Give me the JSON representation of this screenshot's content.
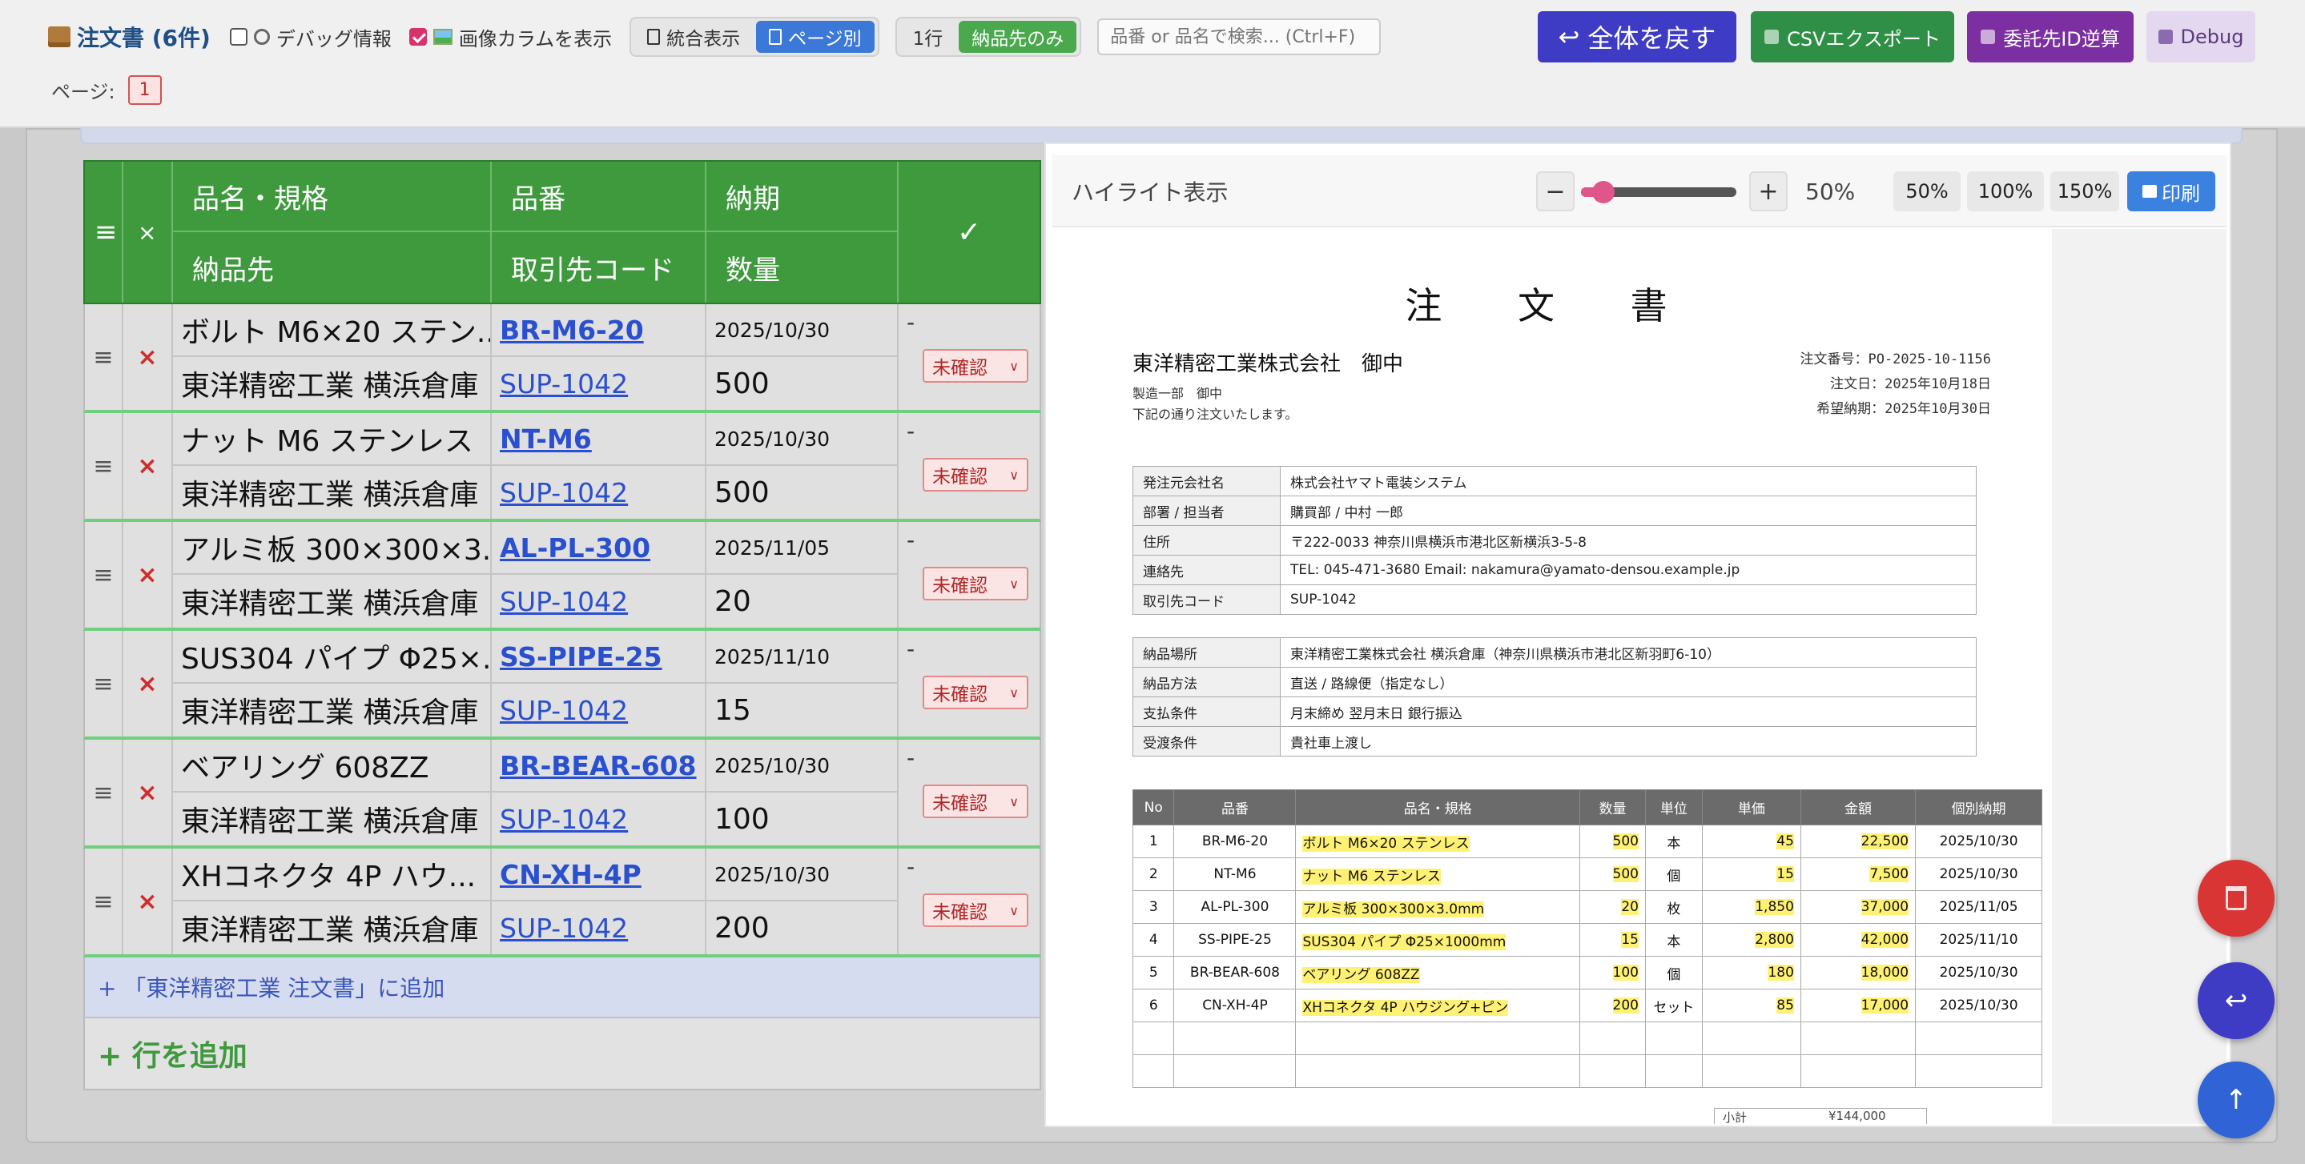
{
  "header": {
    "title": "注文書 (6件)",
    "debug_info_label": "デバッグ情報",
    "image_column_label": "画像カラムを表示",
    "view_combined": "統合表示",
    "view_by_page": "ページ別",
    "one_row": "1行",
    "delivery_only": "納品先のみ",
    "search_placeholder": "品番 or 品名で検索... (Ctrl+F)",
    "revert_all": "全体を戻す",
    "csv_export": "CSVエクスポート",
    "consignee_id_calc": "委託先ID逆算",
    "debug": "Debug",
    "page_label": "ページ:",
    "page_number": "1",
    "revert_icon": "↩"
  },
  "table": {
    "headers": {
      "drag": "≡",
      "delete": "×",
      "name_spec": "品名・規格",
      "delivery_dest": "納品先",
      "part_no": "品番",
      "supplier_code": "取引先コード",
      "due_date": "納期",
      "quantity": "数量",
      "check": "✓"
    },
    "rows": [
      {
        "name": "ボルト M6×20 ステン...",
        "code": "BR-M6-20",
        "date": "2025/10/30",
        "dest": "東洋精密工業 横浜倉庫",
        "sup": "SUP-1042",
        "qty": "500",
        "dash": "-",
        "status": "未確認"
      },
      {
        "name": "ナット M6 ステンレス",
        "code": "NT-M6",
        "date": "2025/10/30",
        "dest": "東洋精密工業 横浜倉庫",
        "sup": "SUP-1042",
        "qty": "500",
        "dash": "-",
        "status": "未確認"
      },
      {
        "name": "アルミ板 300×300×3....",
        "code": "AL-PL-300",
        "date": "2025/11/05",
        "dest": "東洋精密工業 横浜倉庫",
        "sup": "SUP-1042",
        "qty": "20",
        "dash": "-",
        "status": "未確認"
      },
      {
        "name": "SUS304 パイプ Φ25×...",
        "code": "SS-PIPE-25",
        "date": "2025/11/10",
        "dest": "東洋精密工業 横浜倉庫",
        "sup": "SUP-1042",
        "qty": "15",
        "dash": "-",
        "status": "未確認"
      },
      {
        "name": "ベアリング 608ZZ",
        "code": "BR-BEAR-608",
        "date": "2025/10/30",
        "dest": "東洋精密工業 横浜倉庫",
        "sup": "SUP-1042",
        "qty": "100",
        "dash": "-",
        "status": "未確認"
      },
      {
        "name": "XHコネクタ 4P ハウ...",
        "code": "CN-XH-4P",
        "date": "2025/10/30",
        "dest": "東洋精密工業 横浜倉庫",
        "sup": "SUP-1042",
        "qty": "200",
        "dash": "-",
        "status": "未確認"
      }
    ],
    "add_to_supplier": "+ 「東洋精密工業 注文書」に追加",
    "add_row": "+ 行を追加"
  },
  "panel": {
    "title": "ハイライト表示",
    "zoom_minus": "−",
    "zoom_plus": "+",
    "zoom_level": "50%",
    "zoom_value": 50,
    "preset_50": "50%",
    "preset_100": "100%",
    "preset_150": "150%",
    "print": "印刷"
  },
  "document": {
    "title": "注 文 書",
    "to_name": "東洋精密工業株式会社　御中",
    "to_dept": "製造一部　御中",
    "to_msg": "下記の通り注文いたします。",
    "order_no": "注文番号：PO-2025-10-1156",
    "order_date": "注文日：2025年10月18日",
    "wish_date": "希望納期：2025年10月30日",
    "info1": [
      {
        "k": "発注元会社名",
        "v": "株式会社ヤマト電装システム"
      },
      {
        "k": "部署 / 担当者",
        "v": "購買部 / 中村 一郎"
      },
      {
        "k": "住所",
        "v": "〒222-0033 神奈川県横浜市港北区新横浜3-5-8"
      },
      {
        "k": "連絡先",
        "v": "TEL: 045-471-3680  Email: nakamura@yamato-densou.example.jp"
      },
      {
        "k": "取引先コード",
        "v": "SUP-1042"
      }
    ],
    "info2": [
      {
        "k": "納品場所",
        "v": "東洋精密工業株式会社 横浜倉庫（神奈川県横浜市港北区新羽町6-10）"
      },
      {
        "k": "納品方法",
        "v": "直送 / 路線便（指定なし）"
      },
      {
        "k": "支払条件",
        "v": "月末締め 翌月末日 銀行振込"
      },
      {
        "k": "受渡条件",
        "v": "貴社車上渡し"
      }
    ],
    "item_headers": [
      "No",
      "品番",
      "品名・規格",
      "数量",
      "単位",
      "単価",
      "金額",
      "個別納期"
    ],
    "items": [
      {
        "no": "1",
        "code": "BR-M6-20",
        "name": "ボルト M6×20 ステンレス",
        "qty": "500",
        "unit": "本",
        "price": "45",
        "amount": "22,500",
        "due": "2025/10/30"
      },
      {
        "no": "2",
        "code": "NT-M6",
        "name": "ナット M6 ステンレス",
        "qty": "500",
        "unit": "個",
        "price": "15",
        "amount": "7,500",
        "due": "2025/10/30"
      },
      {
        "no": "3",
        "code": "AL-PL-300",
        "name": "アルミ板 300×300×3.0mm",
        "qty": "20",
        "unit": "枚",
        "price": "1,850",
        "amount": "37,000",
        "due": "2025/11/05"
      },
      {
        "no": "4",
        "code": "SS-PIPE-25",
        "name": "SUS304 パイプ Φ25×1000mm",
        "qty": "15",
        "unit": "本",
        "price": "2,800",
        "amount": "42,000",
        "due": "2025/11/10"
      },
      {
        "no": "5",
        "code": "BR-BEAR-608",
        "name": "ベアリング 608ZZ",
        "qty": "100",
        "unit": "個",
        "price": "180",
        "amount": "18,000",
        "due": "2025/10/30"
      },
      {
        "no": "6",
        "code": "CN-XH-4P",
        "name": "XHコネクタ 4P ハウジング+ピン",
        "qty": "200",
        "unit": "セット",
        "price": "85",
        "amount": "17,000",
        "due": "2025/10/30"
      }
    ],
    "subtotal_label": "小計",
    "subtotal_value": "¥144,000"
  },
  "fabs": {
    "undo": "↩",
    "top": "↑"
  },
  "colors": {
    "header_green": "#3f9a3e",
    "revert": "#3e3bc4",
    "csv": "#2f8f47",
    "idcalc": "#7b2fa0",
    "accent_pink": "#e0558a",
    "highlight_yellow": "#fff173"
  }
}
